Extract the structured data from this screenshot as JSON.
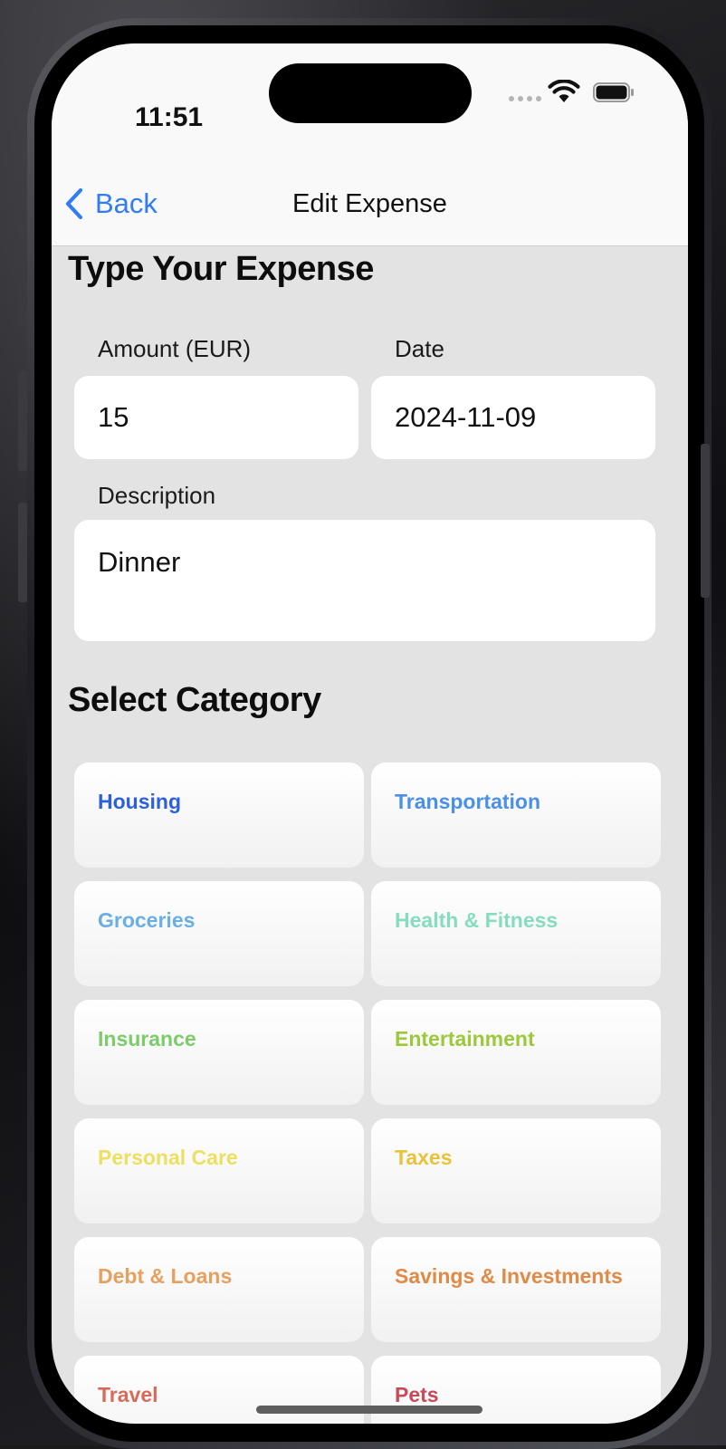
{
  "status_bar": {
    "time": "11:51"
  },
  "nav": {
    "back_label": "Back",
    "title": "Edit Expense"
  },
  "form": {
    "section_title": "Type Your Expense",
    "amount": {
      "label": "Amount (EUR)",
      "value": "15"
    },
    "date": {
      "label": "Date",
      "value": "2024-11-09"
    },
    "description": {
      "label": "Description",
      "value": "Dinner"
    }
  },
  "categories": {
    "section_title": "Select Category",
    "items": [
      {
        "label": "Housing",
        "color": "#2b5fe0"
      },
      {
        "label": "Transportation",
        "color": "#4a90e8"
      },
      {
        "label": "Groceries",
        "color": "#6aaee6"
      },
      {
        "label": "Health & Fitness",
        "color": "#86dcc0"
      },
      {
        "label": "Insurance",
        "color": "#7ccc6a"
      },
      {
        "label": "Entertainment",
        "color": "#9cc83c"
      },
      {
        "label": "Personal Care",
        "color": "#ece060"
      },
      {
        "label": "Taxes",
        "color": "#e8c23a"
      },
      {
        "label": "Debt & Loans",
        "color": "#e8a060"
      },
      {
        "label": "Savings & Investments",
        "color": "#e08a48"
      },
      {
        "label": "Travel",
        "color": "#d86a5a"
      },
      {
        "label": "Pets",
        "color": "#c84a5a"
      }
    ]
  },
  "colors": {
    "accent": "#2f7cf6",
    "background": "#e3e3e3"
  }
}
